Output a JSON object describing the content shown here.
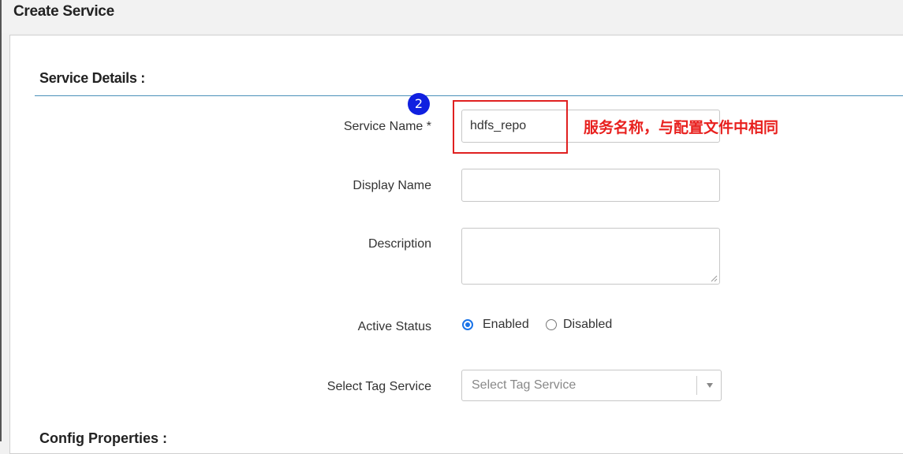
{
  "header": {
    "title": "Create Service"
  },
  "section": {
    "title": "Service Details :"
  },
  "step_badge": "2",
  "annotation": "服务名称，与配置文件中相同",
  "form": {
    "service_name": {
      "label": "Service Name *",
      "value": "hdfs_repo"
    },
    "display_name": {
      "label": "Display Name",
      "value": ""
    },
    "description": {
      "label": "Description",
      "value": ""
    },
    "active_status": {
      "label": "Active Status",
      "options": [
        "Enabled",
        "Disabled"
      ],
      "selected": "Enabled"
    },
    "tag_service": {
      "label": "Select Tag Service",
      "placeholder": "Select Tag Service"
    }
  },
  "next_section": {
    "title": "Config Properties :"
  },
  "colors": {
    "accent": "#1a73e8",
    "annotation": "#e8201e",
    "badge": "#1020e0",
    "rule": "#4a90b8"
  },
  "icons": {
    "select_arrow": "chevron-down-icon",
    "textarea_grip": "resize-grip-icon"
  }
}
